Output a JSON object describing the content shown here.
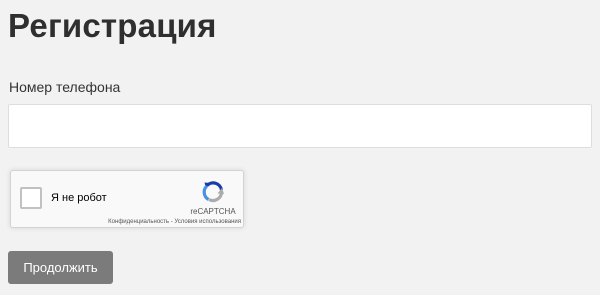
{
  "page": {
    "title": "Регистрация"
  },
  "form": {
    "phone_label": "Номер телефона",
    "phone_value": "",
    "phone_placeholder": "",
    "submit_label": "Продолжить",
    "submit_color": "#7b7b7b"
  },
  "recaptcha": {
    "checkbox_label": "Я не робот",
    "checked": false,
    "brand": "reCAPTCHA",
    "logo_icon": "recaptcha-logo-icon",
    "privacy_link": "Конфиденциальность",
    "separator": " - ",
    "terms_link": "Условия использования"
  }
}
